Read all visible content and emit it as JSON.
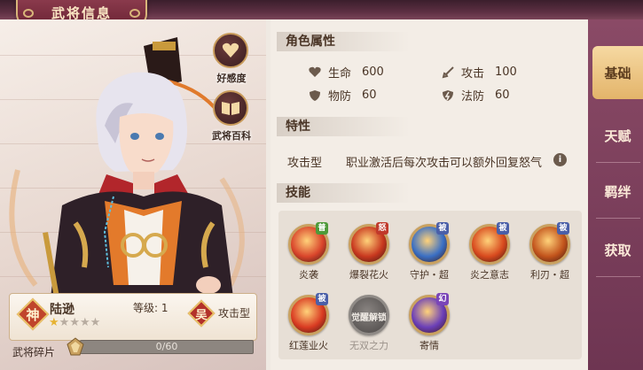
{
  "header": {
    "title": "武将信息"
  },
  "portrait": {
    "affinity_label": "好感度",
    "encyclopedia_label": "武将百科"
  },
  "hero": {
    "rarity": "神",
    "name": "陆逊",
    "level_label": "等级:",
    "level": "1",
    "faction": "吴",
    "type": "攻击型",
    "stars_filled": 1,
    "stars_total": 5,
    "shards_label": "武将碎片",
    "shards_text": "0/60",
    "shards_progress": 0
  },
  "attributes": {
    "heading": "角色属性",
    "items": [
      {
        "icon": "heart-icon",
        "label": "生命",
        "value": "600"
      },
      {
        "icon": "sword-icon",
        "label": "攻击",
        "value": "100"
      },
      {
        "icon": "shield-icon",
        "label": "物防",
        "value": "60"
      },
      {
        "icon": "magic-shield-icon",
        "label": "法防",
        "value": "60"
      }
    ]
  },
  "trait": {
    "heading": "特性",
    "name": "攻击型",
    "description": "职业激活后每次攻击可以额外回复怒气"
  },
  "skills": {
    "heading": "技能",
    "items": [
      {
        "label": "炎袭",
        "tag": "普",
        "color": "#d9452b",
        "locked": false
      },
      {
        "label": "爆裂花火",
        "tag": "怒",
        "color": "#c8381f",
        "locked": false
      },
      {
        "label": "守护・超",
        "tag": "被",
        "color": "#3a6fc4",
        "locked": false
      },
      {
        "label": "炎之意志",
        "tag": "被",
        "color": "#d84a1e",
        "locked": false
      },
      {
        "label": "利刃・超",
        "tag": "被",
        "color": "#c2541c",
        "locked": false
      },
      {
        "label": "红莲业火",
        "tag": "被",
        "color": "#d93b22",
        "locked": false
      },
      {
        "label": "无双之力",
        "tag": "",
        "color": "#6c6866",
        "locked": true,
        "overlay": "觉醒解锁"
      },
      {
        "label": "寄情",
        "tag": "幻",
        "color": "#6b3fb8",
        "locked": false
      }
    ]
  },
  "side_tabs": [
    {
      "label": "基础",
      "active": true
    },
    {
      "label": "天赋",
      "active": false
    },
    {
      "label": "羁绊",
      "active": false
    },
    {
      "label": "获取",
      "active": false
    }
  ]
}
